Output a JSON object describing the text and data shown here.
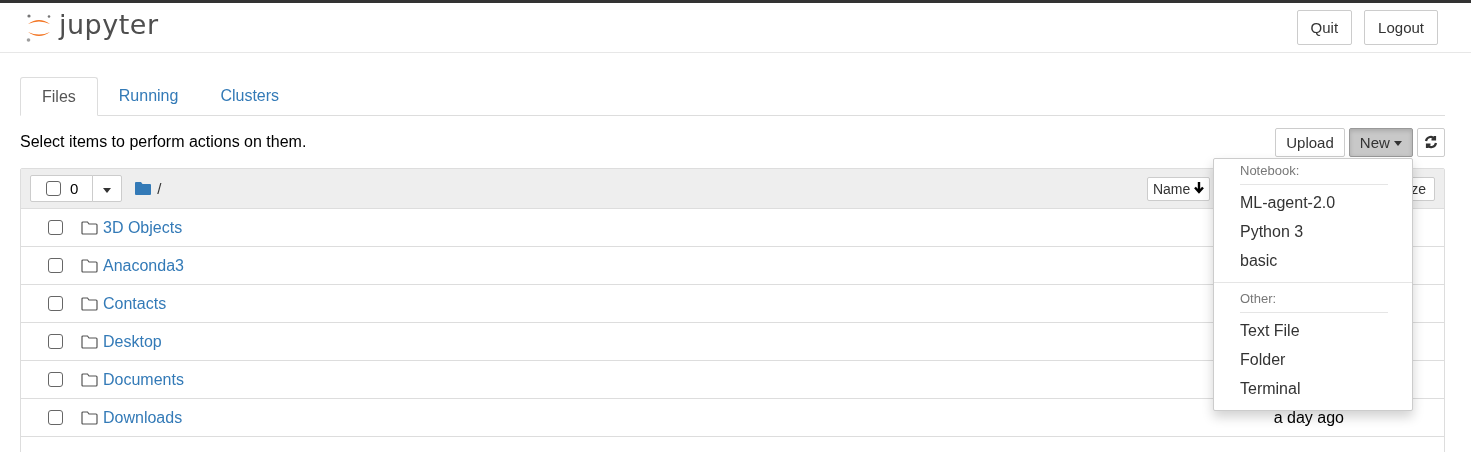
{
  "header": {
    "logo_text": "jupyter",
    "buttons": [
      "Quit",
      "Logout"
    ]
  },
  "tabs": [
    {
      "label": "Files",
      "selected": true
    },
    {
      "label": "Running",
      "selected": false
    },
    {
      "label": "Clusters",
      "selected": false
    }
  ],
  "hint": "Select items to perform actions on them.",
  "toolbar": {
    "upload": "Upload",
    "new": "New",
    "new_open": true
  },
  "list_header": {
    "selected_count": "0",
    "path": "/",
    "sort_button": "Name",
    "size_button": "ze"
  },
  "rows": [
    {
      "name": "3D Objects",
      "checked": false
    },
    {
      "name": "Anaconda3",
      "checked": false
    },
    {
      "name": "Contacts",
      "checked": false
    },
    {
      "name": "Desktop",
      "checked": false
    },
    {
      "name": "Documents",
      "checked": false
    },
    {
      "name": "Downloads",
      "checked": false,
      "modified": "a day ago"
    }
  ],
  "new_menu": {
    "sections": [
      {
        "title": "Notebook:",
        "items": [
          "ML-agent-2.0",
          "Python 3",
          "basic"
        ]
      },
      {
        "title": "Other:",
        "items": [
          "Text File",
          "Folder",
          "Terminal"
        ]
      }
    ]
  }
}
